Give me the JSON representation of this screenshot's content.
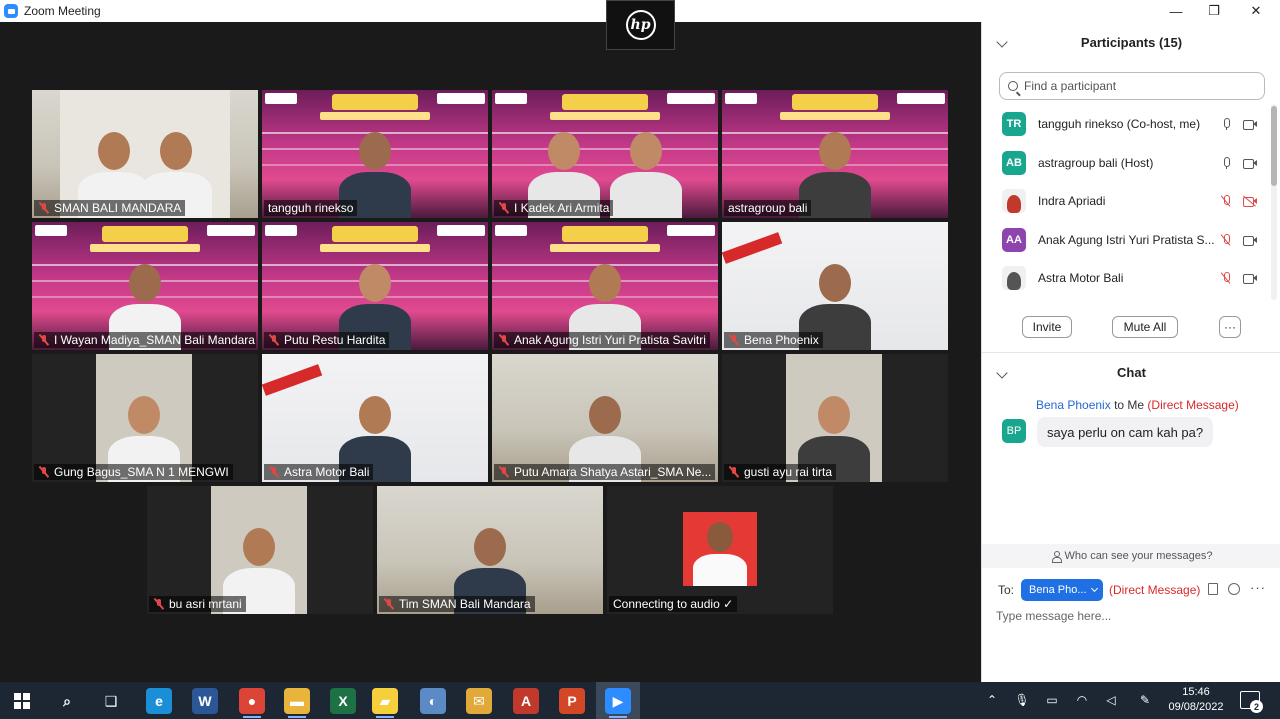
{
  "window": {
    "title": "Zoom Meeting",
    "minimize_glyph": "—",
    "restore_glyph": "❐",
    "close_glyph": "✕"
  },
  "overlay": {
    "brand_logo": "hp"
  },
  "tiles": [
    {
      "name": "SMAN BALI MANDARA",
      "muted": true,
      "bg": "room"
    },
    {
      "name": "tangguh rinekso",
      "muted": false,
      "bg": "banner"
    },
    {
      "name": "I Kadek Ari Armita",
      "muted": true,
      "bg": "banner"
    },
    {
      "name": "astragroup bali",
      "muted": false,
      "bg": "banner",
      "active": true
    },
    {
      "name": "I Wayan Madiya_SMAN Bali Mandara",
      "muted": true,
      "bg": "banner"
    },
    {
      "name": "Putu Restu Hardita",
      "muted": true,
      "bg": "banner"
    },
    {
      "name": "Anak Agung Istri Yuri Pratista Savitri",
      "muted": true,
      "bg": "banner"
    },
    {
      "name": "Bena Phoenix",
      "muted": true,
      "bg": "white"
    },
    {
      "name": "Gung Bagus_SMA N 1 MENGWI",
      "muted": true,
      "bg": "dark"
    },
    {
      "name": "Astra Motor Bali",
      "muted": true,
      "bg": "white"
    },
    {
      "name": "Putu Amara Shatya Astari_SMA Ne...",
      "muted": true,
      "bg": "room"
    },
    {
      "name": "gusti ayu rai tirta",
      "muted": true,
      "bg": "dark"
    },
    {
      "name": "bu asri mrtani",
      "muted": true,
      "bg": "dark"
    },
    {
      "name": "Tim SMAN Bali Mandara",
      "muted": true,
      "bg": "room"
    },
    {
      "name": "Connecting to audio ✓",
      "muted": false,
      "bg": "dark"
    }
  ],
  "participants_panel": {
    "title": "Participants (15)",
    "search_placeholder": "Find a participant",
    "items": [
      {
        "initials": "TR",
        "name": "tangguh rinekso (Co-host, me)",
        "color": "#19a68f",
        "mic": "on",
        "cam": "on"
      },
      {
        "initials": "AB",
        "name": "astragroup bali (Host)",
        "color": "#19a68f",
        "mic": "on",
        "cam": "on"
      },
      {
        "initials": "",
        "name": "Indra Apriadi",
        "color": "#c0392b",
        "mic": "off",
        "cam": "off"
      },
      {
        "initials": "AA",
        "name": "Anak Agung Istri Yuri Pratista S...",
        "color": "#8e44ad",
        "mic": "off",
        "cam": "on"
      },
      {
        "initials": "",
        "name": "Astra Motor Bali",
        "color": "#555555",
        "mic": "off",
        "cam": "on"
      }
    ],
    "invite_label": "Invite",
    "mute_all_label": "Mute All",
    "more_label": "···"
  },
  "chat": {
    "title": "Chat",
    "messages": [
      {
        "sender": "Bena Phoenix",
        "to": " to Me ",
        "dm_tag": "(Direct Message)",
        "initials": "BP",
        "text": "saya perlu on cam kah pa?"
      }
    ],
    "who_can_see": "Who can see your messages?",
    "to_label": "To:",
    "to_value": "Bena Pho...",
    "to_dm_tag": "(Direct Message)",
    "input_placeholder": "Type message here...",
    "more_glyph": "···"
  },
  "taskbar": {
    "time": "15:46",
    "date": "09/08/2022",
    "notification_count": "2",
    "apps": [
      {
        "name": "search-icon",
        "glyph": "⌕",
        "color": "transparent"
      },
      {
        "name": "task-view-icon",
        "glyph": "❑",
        "color": "transparent"
      },
      {
        "name": "edge-icon",
        "glyph": "e",
        "color": "#1a8fd8"
      },
      {
        "name": "word-icon",
        "glyph": "W",
        "color": "#2b5797"
      },
      {
        "name": "chrome-icon",
        "glyph": "●",
        "color": "#db4437"
      },
      {
        "name": "file-explorer-icon",
        "glyph": "▬",
        "color": "#e9b43c"
      },
      {
        "name": "excel-icon",
        "glyph": "X",
        "color": "#1e7145"
      },
      {
        "name": "sticky-notes-icon",
        "glyph": "▰",
        "color": "#f6d03c"
      },
      {
        "name": "paint-icon",
        "glyph": "◐",
        "color": "#5b8ac7"
      },
      {
        "name": "mail-icon",
        "glyph": "✉",
        "color": "#e0a93a"
      },
      {
        "name": "acrobat-icon",
        "glyph": "A",
        "color": "#c0392b"
      },
      {
        "name": "powerpoint-icon",
        "glyph": "P",
        "color": "#d24726"
      },
      {
        "name": "zoom-icon",
        "glyph": "▶",
        "color": "#2d8cff"
      }
    ]
  }
}
